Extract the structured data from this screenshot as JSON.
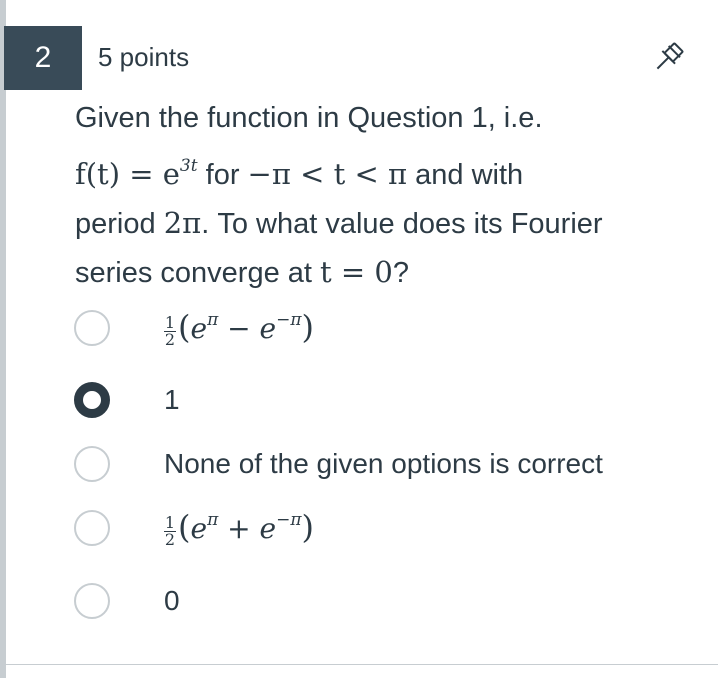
{
  "question": {
    "number": "2",
    "points": "5 points",
    "text_line1": "Given the function in Question 1, i.e.",
    "func_lhs": "f(t) = e",
    "func_exp": "3t",
    "func_for": "for",
    "func_range": "−π < t < π",
    "func_and": "and with",
    "period_word": "period",
    "period_val": "2π",
    "period_rest": ". To what value does its Fourier",
    "series_text": "series converge at",
    "series_math": "t = 0",
    "series_q": "?"
  },
  "options": [
    {
      "frac_num": "1",
      "frac_den": "2",
      "paren_open": "(",
      "e1": "e",
      "exp1": "π",
      "op": " − ",
      "e2": "e",
      "exp2": "−π",
      "paren_close": ")",
      "selected": false
    },
    {
      "label": "1",
      "selected": true
    },
    {
      "label": "None of the given options is correct",
      "selected": false
    },
    {
      "frac_num": "1",
      "frac_den": "2",
      "paren_open": "(",
      "e1": "e",
      "exp1": "π",
      "op": " + ",
      "e2": "e",
      "exp2": "−π",
      "paren_close": ")",
      "selected": false
    },
    {
      "label": "0",
      "selected": false
    }
  ],
  "icons": {
    "pin": "pin-icon"
  },
  "colors": {
    "badge_bg": "#394b58",
    "text": "#2d3b45",
    "radio_border": "#c7cdd1"
  }
}
